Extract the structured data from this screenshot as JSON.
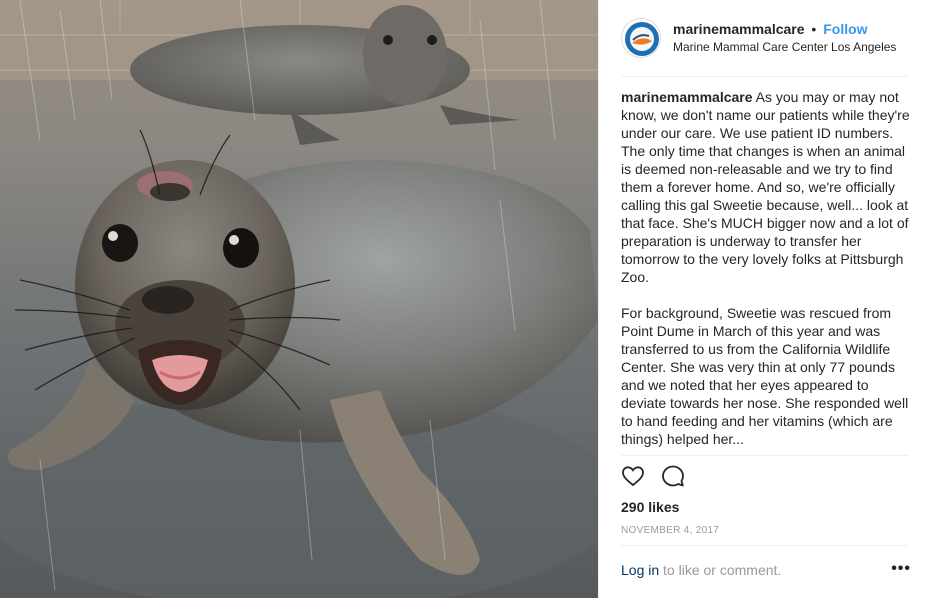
{
  "header": {
    "username": "marinemammalcare",
    "separator": "•",
    "follow_label": "Follow",
    "location": "Marine Mammal Care Center Los Angeles"
  },
  "caption": {
    "username": "marinemammalcare",
    "paragraph1": "As you may or may not know, we don't name our patients while they're under our care. We use patient ID numbers. The only time that changes is when an animal is deemed non-releasable and we try to find them a forever home. And so, we're officially calling this gal Sweetie because, well... look at that face. She's MUCH bigger now and a lot of preparation is underway to transfer her tomorrow to the very lovely folks at Pittsburgh Zoo.",
    "paragraph2": "For background, Sweetie was rescued from Point Dume in March of this year and was transferred to us from the California Wildlife Center. She was very thin at only 77 pounds and we noted that her eyes appeared to deviate towards her nose. She responded well to hand feeding and her vitamins (which are things) helped her..."
  },
  "actions": {
    "like_icon": "heart-icon",
    "comment_icon": "comment-icon"
  },
  "likes": "290 likes",
  "date": "NOVEMBER 4, 2017",
  "footer": {
    "login_label": "Log in",
    "rest_text": " to like or comment.",
    "more_label": "•••"
  },
  "colors": {
    "follow": "#3897f0",
    "login": "#003569",
    "muted": "#999999",
    "text": "#262626"
  }
}
